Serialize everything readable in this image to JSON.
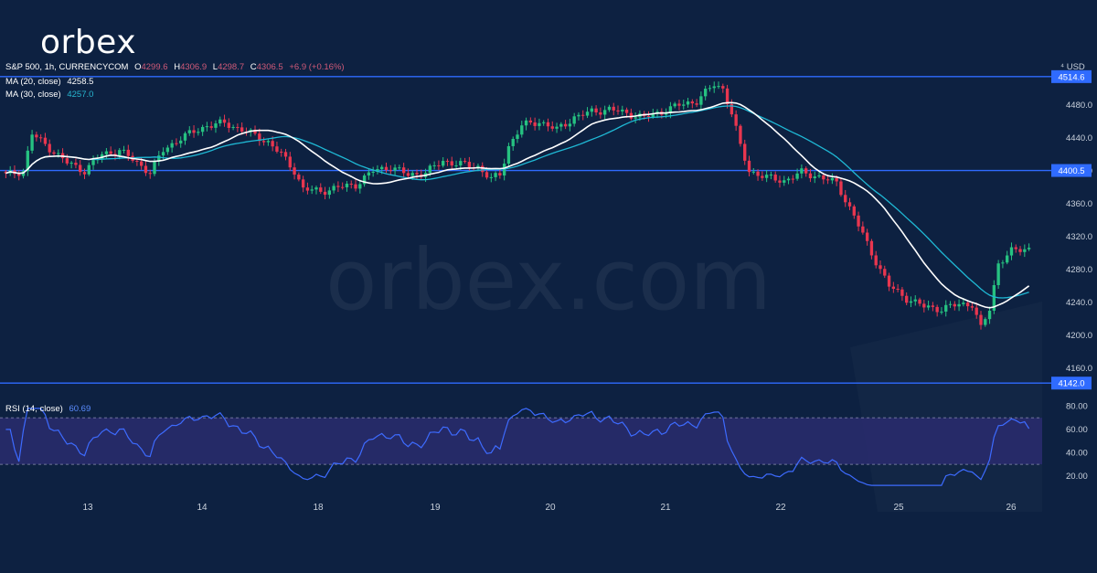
{
  "brand": {
    "logo_text": "orbex",
    "watermark": "orbex.com"
  },
  "header": {
    "symbol": "S&P 500, 1h, CURRENCYCOM",
    "ohlc": {
      "o_label": "O",
      "o": "4299.6",
      "h_label": "H",
      "h": "4306.9",
      "l_label": "L",
      "l": "4298.7",
      "c_label": "C",
      "c": "4306.5",
      "change": "+6.9 (+0.16%)"
    },
    "ma20_label": "MA (20, close)",
    "ma20_value": "4258.5",
    "ma30_label": "MA (30, close)",
    "ma30_value": "4257.0",
    "rsi_label": "RSI (14, close)",
    "rsi_value": "60.69",
    "currency": "USD"
  },
  "colors": {
    "background": "#0d2141",
    "up": "#26c281",
    "down": "#e8364f",
    "ma20": "#ffffff",
    "ma30": "#1fb8d4",
    "level_line": "#2f6bff",
    "rsi_line": "#3d6bff",
    "rsi_band": "#2a2c6e",
    "axis_text": "#c9d1dc"
  },
  "chart_data": {
    "type": "candlestick",
    "title": "S&P 500, 1h, CURRENCYCOM",
    "ylabel": "USD",
    "ylim": [
      4130,
      4530
    ],
    "y_ticks": [
      4160,
      4200,
      4240,
      4280,
      4320,
      4360,
      4400,
      4440,
      4480
    ],
    "y_ticks_labels": [
      "4160.0",
      "4200.0",
      "4240.0",
      "4280.0",
      "4320.0",
      "4360.0",
      "4400.0",
      "4440.0",
      "4480.0"
    ],
    "x_ticks": [
      "13",
      "14",
      "18",
      "19",
      "20",
      "21",
      "22",
      "25",
      "26"
    ],
    "horizontal_levels": [
      {
        "value": 4514.6,
        "label": "4514.6"
      },
      {
        "value": 4400.5,
        "label": "4400.5"
      },
      {
        "value": 4142.0,
        "label": "4142.0"
      }
    ],
    "close_anchors": [
      [
        0,
        4395
      ],
      [
        4,
        4400
      ],
      [
        6,
        4445
      ],
      [
        9,
        4432
      ],
      [
        14,
        4410
      ],
      [
        18,
        4400
      ],
      [
        22,
        4420
      ],
      [
        26,
        4425
      ],
      [
        30,
        4410
      ],
      [
        33,
        4398
      ],
      [
        36,
        4425
      ],
      [
        40,
        4440
      ],
      [
        46,
        4455
      ],
      [
        50,
        4458
      ],
      [
        55,
        4448
      ],
      [
        60,
        4435
      ],
      [
        63,
        4420
      ],
      [
        66,
        4400
      ],
      [
        68,
        4378
      ],
      [
        72,
        4375
      ],
      [
        76,
        4380
      ],
      [
        80,
        4383
      ],
      [
        84,
        4400
      ],
      [
        88,
        4405
      ],
      [
        92,
        4395
      ],
      [
        96,
        4398
      ],
      [
        100,
        4412
      ],
      [
        104,
        4408
      ],
      [
        108,
        4405
      ],
      [
        111,
        4390
      ],
      [
        113,
        4395
      ],
      [
        115,
        4430
      ],
      [
        118,
        4455
      ],
      [
        122,
        4460
      ],
      [
        126,
        4450
      ],
      [
        130,
        4465
      ],
      [
        134,
        4472
      ],
      [
        138,
        4475
      ],
      [
        142,
        4470
      ],
      [
        146,
        4465
      ],
      [
        150,
        4472
      ],
      [
        154,
        4480
      ],
      [
        158,
        4485
      ],
      [
        162,
        4505
      ],
      [
        164,
        4500
      ],
      [
        166,
        4470
      ],
      [
        168,
        4430
      ],
      [
        170,
        4400
      ],
      [
        174,
        4392
      ],
      [
        178,
        4388
      ],
      [
        182,
        4398
      ],
      [
        186,
        4393
      ],
      [
        190,
        4385
      ],
      [
        194,
        4345
      ],
      [
        198,
        4300
      ],
      [
        202,
        4260
      ],
      [
        206,
        4245
      ],
      [
        210,
        4235
      ],
      [
        214,
        4232
      ],
      [
        218,
        4238
      ],
      [
        221,
        4238
      ],
      [
        223,
        4208
      ],
      [
        225,
        4232
      ],
      [
        227,
        4288
      ],
      [
        230,
        4302
      ],
      [
        234,
        4306.5
      ]
    ],
    "ma20_last": 4258.5,
    "ma30_last": 4257.0,
    "rsi": {
      "label": "RSI (14, close)",
      "last": 60.69,
      "ylim": [
        5,
        85
      ],
      "y_ticks": [
        20,
        40,
        60,
        80
      ],
      "y_ticks_labels": [
        "20.00",
        "40.00",
        "60.00",
        "80.00"
      ],
      "band": [
        30,
        70
      ]
    }
  }
}
